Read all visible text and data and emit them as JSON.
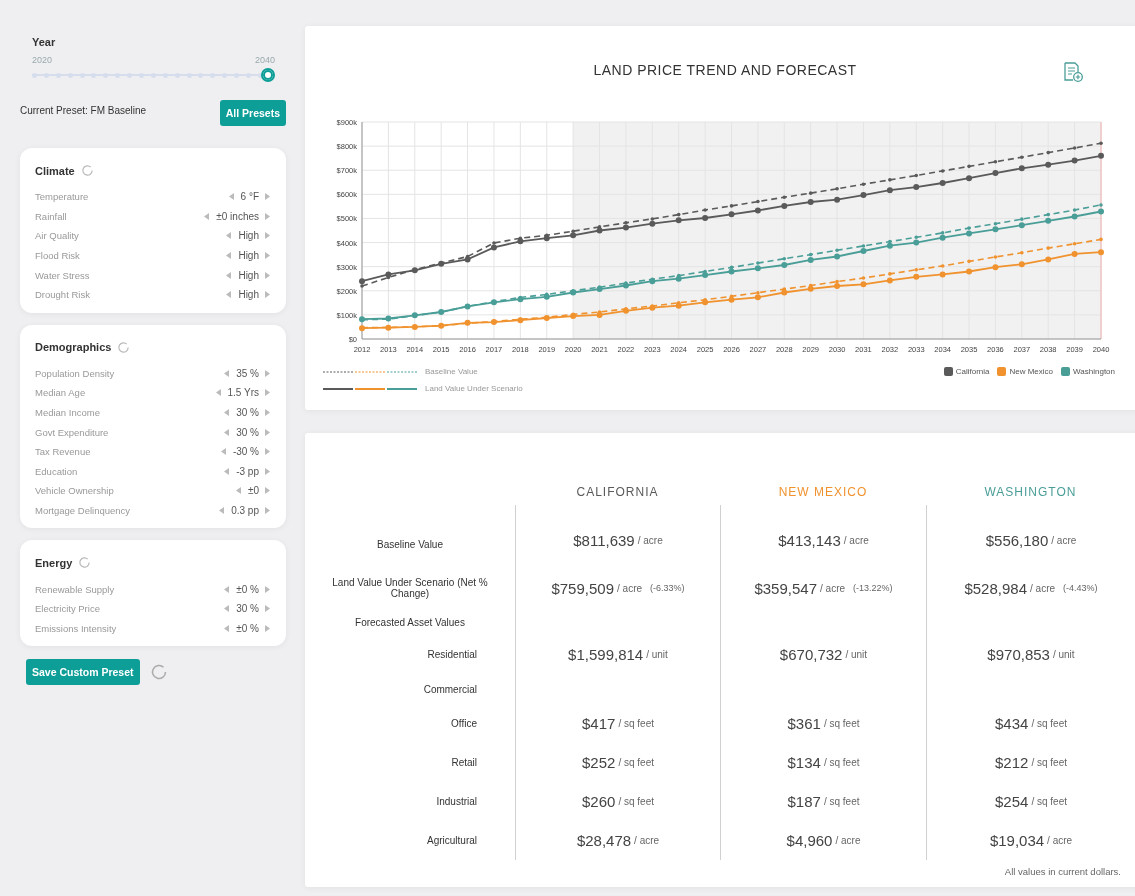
{
  "year_slider": {
    "label": "Year",
    "min_label": "2020",
    "max_label": "2040",
    "level": 1
  },
  "preset": {
    "label": "Current Preset: FM Baseline",
    "button": "All Presets"
  },
  "sections": [
    {
      "title": "Climate",
      "rows": [
        {
          "label": "Temperature",
          "value": "6 °F"
        },
        {
          "label": "Rainfall",
          "value": "±0 inches"
        },
        {
          "label": "Air Quality",
          "value": "High"
        },
        {
          "label": "Flood Risk",
          "value": "High"
        },
        {
          "label": "Water Stress",
          "value": "High"
        },
        {
          "label": "Drought Risk",
          "value": "High"
        }
      ]
    },
    {
      "title": "Demographics",
      "rows": [
        {
          "label": "Population Density",
          "value": "35 %"
        },
        {
          "label": "Median Age",
          "value": "1.5 Yrs"
        },
        {
          "label": "Median Income",
          "value": "30 %"
        },
        {
          "label": "Govt Expenditure",
          "value": "30 %"
        },
        {
          "label": "Tax Revenue",
          "value": "-30 %"
        },
        {
          "label": "Education",
          "value": "-3 pp"
        },
        {
          "label": "Vehicle Ownership",
          "value": "±0"
        },
        {
          "label": "Mortgage Delinquency",
          "value": "0.3 pp"
        }
      ]
    },
    {
      "title": "Energy",
      "rows": [
        {
          "label": "Renewable Supply",
          "value": "±0 %"
        },
        {
          "label": "Electricity Price",
          "value": "30 %"
        },
        {
          "label": "Emissions Intensity",
          "value": "±0 %"
        }
      ]
    }
  ],
  "save_button": "Save Custom Preset",
  "chart": {
    "legend_styles": [
      {
        "label": "Baseline Value",
        "kind": "dashed"
      },
      {
        "label": "Land Value Under Scenario",
        "kind": "solid"
      }
    ],
    "chart_data": {
      "type": "line",
      "title": "LAND PRICE TREND AND FORECAST",
      "x": [
        2012,
        2013,
        2014,
        2015,
        2016,
        2017,
        2018,
        2019,
        2020,
        2021,
        2022,
        2023,
        2024,
        2025,
        2026,
        2027,
        2028,
        2029,
        2030,
        2031,
        2032,
        2033,
        2034,
        2035,
        2036,
        2037,
        2038,
        2039,
        2040
      ],
      "xticks": [
        2012,
        2013,
        2014,
        2015,
        2016,
        2017,
        2018,
        2019,
        2020,
        2021,
        2022,
        2023,
        2024,
        2025,
        2026,
        2027,
        2028,
        2029,
        2030,
        2031,
        2032,
        2033,
        2034,
        2035,
        2036,
        2037,
        2038,
        2039,
        2040
      ],
      "xlim": [
        2012,
        2040
      ],
      "ylim": [
        0,
        900000
      ],
      "grid": true,
      "bands": [
        {
          "axis": "x",
          "from": 2020,
          "to": 2040,
          "color": "#f1f1f1"
        }
      ],
      "ref_lines": [
        {
          "axis": "x",
          "value": 2040,
          "color": "#f3b0b0"
        }
      ],
      "yticks": [
        {
          "value": 0,
          "label": "$0"
        },
        {
          "value": 100000,
          "label": "$100k"
        },
        {
          "value": 200000,
          "label": "$200k"
        },
        {
          "value": 300000,
          "label": "$300k"
        },
        {
          "value": 400000,
          "label": "$400k"
        },
        {
          "value": 500000,
          "label": "$500k"
        },
        {
          "value": 600000,
          "label": "$600k"
        },
        {
          "value": 700000,
          "label": "$700k"
        },
        {
          "value": 800000,
          "label": "$800k"
        },
        {
          "value": 900000,
          "label": "$900k"
        }
      ],
      "series": [
        {
          "line_style": "dashed",
          "color": "#5a5a5a",
          "values": [
            220000,
            255000,
            288000,
            315000,
            342000,
            398000,
            418000,
            430000,
            447000,
            465000,
            482000,
            498000,
            516000,
            535000,
            552000,
            570000,
            588000,
            605000,
            623000,
            642000,
            660000,
            678000,
            697000,
            716000,
            735000,
            754000,
            773000,
            792000,
            812000
          ]
        },
        {
          "name": "California",
          "line_style": "solid",
          "marker": "circle",
          "color": "#5a5a5a",
          "values": [
            240000,
            268000,
            285000,
            312000,
            330000,
            380000,
            405000,
            418000,
            430000,
            450000,
            462000,
            478000,
            492000,
            502000,
            517000,
            533000,
            552000,
            568000,
            578000,
            597000,
            617000,
            630000,
            647000,
            667000,
            688000,
            708000,
            723000,
            740000,
            760000
          ]
        },
        {
          "line_style": "dashed",
          "color": "#f0922e",
          "values": [
            47000,
            48000,
            50000,
            55000,
            65000,
            72000,
            82000,
            90000,
            102000,
            112000,
            125000,
            137000,
            150000,
            163000,
            177000,
            192000,
            207000,
            222000,
            238000,
            253000,
            270000,
            287000,
            303000,
            322000,
            340000,
            358000,
            377000,
            395000,
            413000
          ]
        },
        {
          "name": "New Mexico",
          "line_style": "solid",
          "marker": "circle",
          "color": "#f0922e",
          "values": [
            45000,
            47000,
            50000,
            55000,
            67000,
            70000,
            78000,
            87000,
            95000,
            100000,
            117000,
            130000,
            138000,
            152000,
            163000,
            173000,
            193000,
            208000,
            220000,
            227000,
            243000,
            258000,
            268000,
            280000,
            298000,
            310000,
            330000,
            353000,
            360000
          ]
        },
        {
          "line_style": "dashed",
          "color": "#4a9e98",
          "values": [
            80000,
            82000,
            97000,
            112000,
            135000,
            155000,
            172000,
            185000,
            200000,
            215000,
            232000,
            248000,
            263000,
            280000,
            297000,
            315000,
            333000,
            350000,
            368000,
            386000,
            404000,
            422000,
            440000,
            460000,
            478000,
            497000,
            516000,
            535000,
            556000
          ]
        },
        {
          "name": "Washington",
          "line_style": "solid",
          "marker": "circle",
          "color": "#4a9e98",
          "values": [
            82000,
            85000,
            98000,
            112000,
            135000,
            152000,
            165000,
            175000,
            193000,
            207000,
            222000,
            240000,
            250000,
            265000,
            280000,
            293000,
            307000,
            328000,
            342000,
            365000,
            387000,
            400000,
            420000,
            438000,
            455000,
            472000,
            490000,
            508000,
            529000
          ]
        }
      ]
    }
  },
  "table": {
    "columns": [
      {
        "label": "CALIFORNIA",
        "color": "#5a5a5a"
      },
      {
        "label": "NEW MEXICO",
        "color": "#f0922e"
      },
      {
        "label": "WASHINGTON",
        "color": "#4a9e98"
      }
    ],
    "rows": [
      {
        "kind": "main",
        "label": "Baseline Value",
        "cells": [
          {
            "value": "$811,639",
            "unit": "/ acre"
          },
          {
            "value": "$413,143",
            "unit": "/ acre"
          },
          {
            "value": "$556,180",
            "unit": "/ acre"
          }
        ]
      },
      {
        "kind": "main",
        "label": "Land Value Under Scenario (Net % Change)",
        "cells": [
          {
            "value": "$759,509",
            "unit": "/ acre",
            "change": "(-6.33%)"
          },
          {
            "value": "$359,547",
            "unit": "/ acre",
            "change": "(-13.22%)"
          },
          {
            "value": "$528,984",
            "unit": "/ acre",
            "change": "(-4.43%)"
          }
        ]
      },
      {
        "kind": "group",
        "label": "Forecasted Asset Values"
      },
      {
        "kind": "sub",
        "label": "Residential",
        "cells": [
          {
            "value": "$1,599,814",
            "unit": "/ unit"
          },
          {
            "value": "$670,732",
            "unit": "/ unit"
          },
          {
            "value": "$970,853",
            "unit": "/ unit"
          }
        ]
      },
      {
        "kind": "subgroup",
        "label": "Commercial"
      },
      {
        "kind": "sub",
        "label": "Office",
        "cells": [
          {
            "value": "$417",
            "unit": "/ sq feet"
          },
          {
            "value": "$361",
            "unit": "/ sq feet"
          },
          {
            "value": "$434",
            "unit": "/ sq feet"
          }
        ]
      },
      {
        "kind": "sub",
        "label": "Retail",
        "cells": [
          {
            "value": "$252",
            "unit": "/ sq feet"
          },
          {
            "value": "$134",
            "unit": "/ sq feet"
          },
          {
            "value": "$212",
            "unit": "/ sq feet"
          }
        ]
      },
      {
        "kind": "sub",
        "label": "Industrial",
        "cells": [
          {
            "value": "$260",
            "unit": "/ sq feet"
          },
          {
            "value": "$187",
            "unit": "/ sq feet"
          },
          {
            "value": "$254",
            "unit": "/ sq feet"
          }
        ]
      },
      {
        "kind": "sub",
        "label": "Agricultural",
        "cells": [
          {
            "value": "$28,478",
            "unit": "/ acre"
          },
          {
            "value": "$4,960",
            "unit": "/ acre"
          },
          {
            "value": "$19,034",
            "unit": "/ acre"
          }
        ]
      }
    ],
    "footnote": "All values in current dollars."
  }
}
